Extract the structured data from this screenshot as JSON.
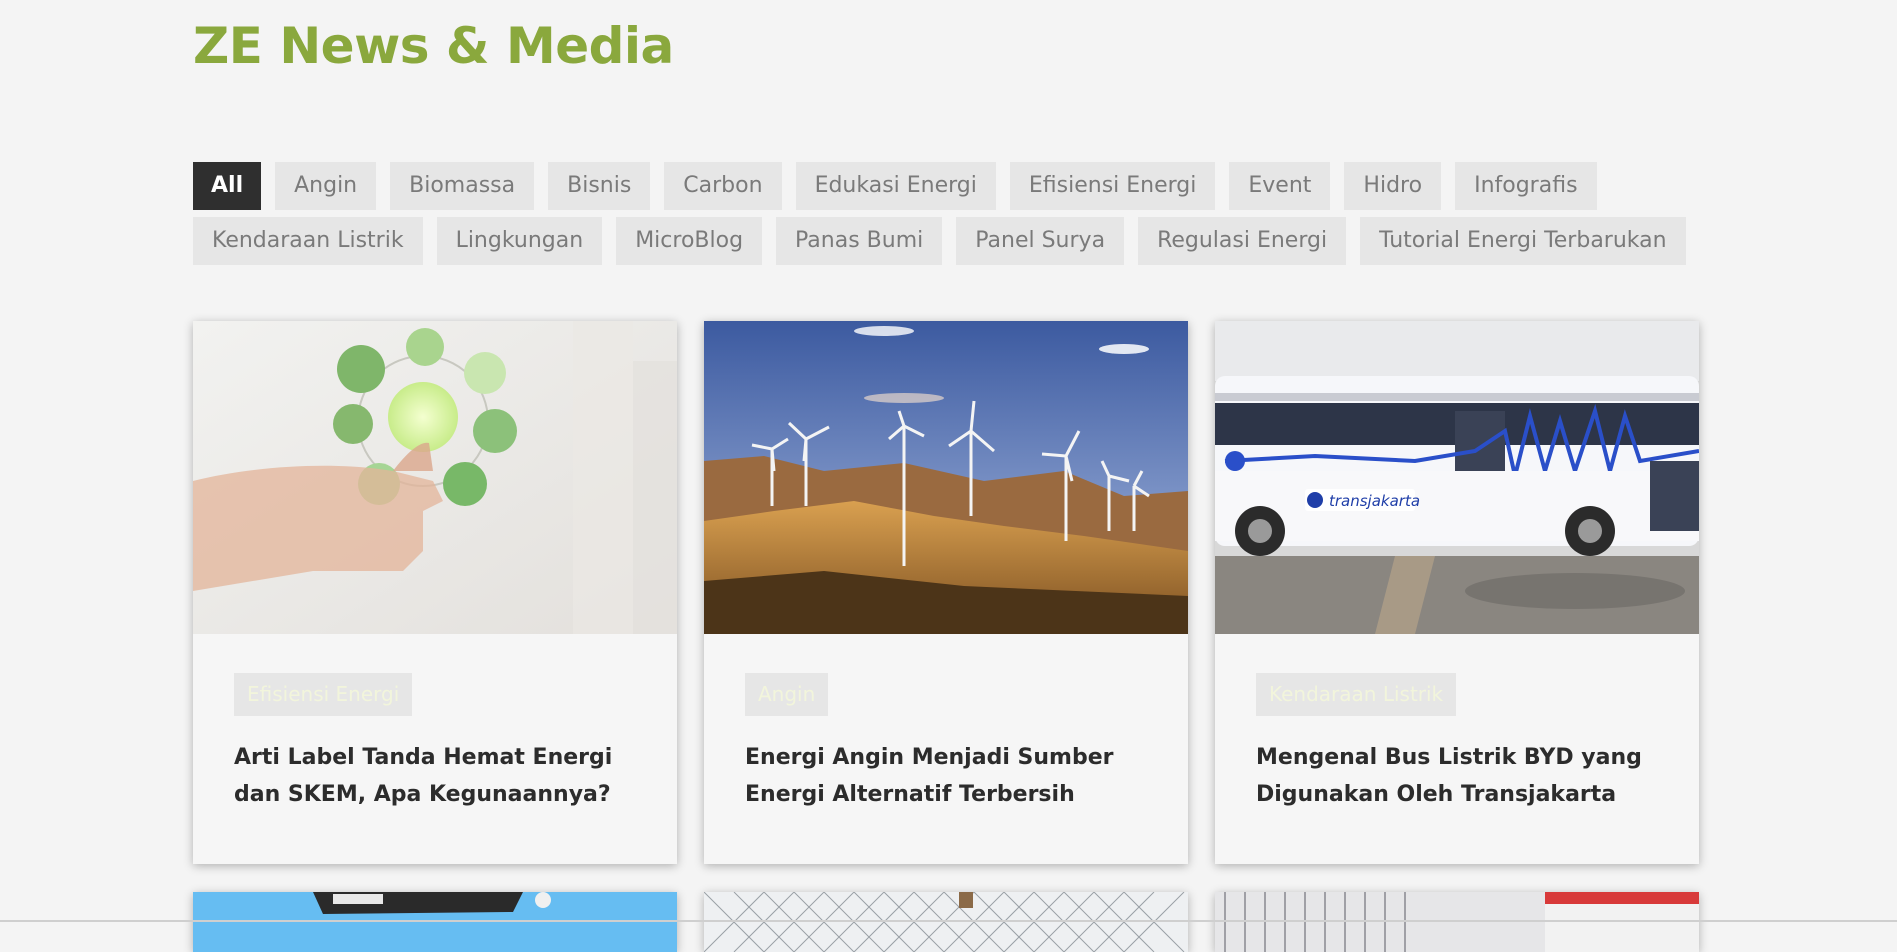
{
  "site": {
    "title": "ZE News & Media",
    "accent": "#8aa83d"
  },
  "filters": {
    "row1": [
      "All",
      "Angin",
      "Biomassa",
      "Bisnis",
      "Carbon",
      "Edukasi Energi",
      "Efisiensi Energi",
      "Event",
      "Hidro",
      "Infografis"
    ],
    "row2": [
      "Kendaraan Listrik",
      "Lingkungan",
      "MicroBlog",
      "Panas Bumi",
      "Panel Surya",
      "Regulasi Energi",
      "Tutorial Energi Terbarukan"
    ],
    "active": "All"
  },
  "cards": [
    {
      "category": "Efisiensi Energi",
      "title": "Arti Label Tanda Hemat Energi dan SKEM, Apa Kegunaannya?"
    },
    {
      "category": "Angin",
      "title": "Energi Angin Menjadi Sumber Energi Alternatif Terbersih"
    },
    {
      "category": "Kendaraan Listrik",
      "title": "Mengenal Bus Listrik BYD yang Digunakan Oleh Transjakarta"
    }
  ],
  "bus_logo_text": "transjakarta"
}
